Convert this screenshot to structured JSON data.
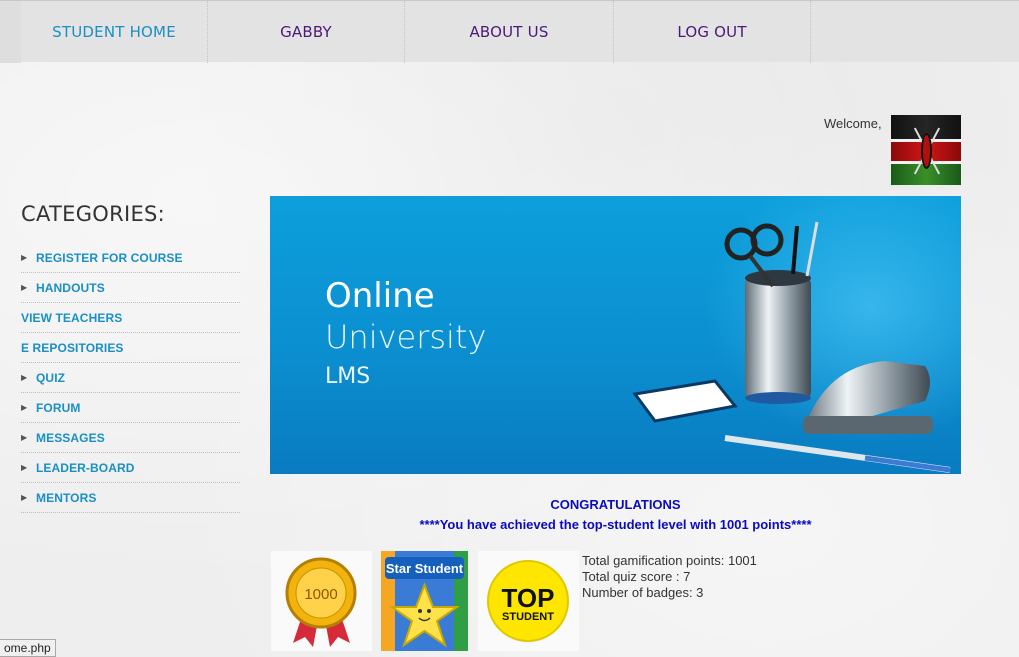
{
  "nav": {
    "items": [
      {
        "label": "STUDENT HOME",
        "active": true
      },
      {
        "label": "GABBY",
        "active": false
      },
      {
        "label": "ABOUT US",
        "active": false
      },
      {
        "label": "LOG OUT",
        "active": false
      }
    ]
  },
  "header": {
    "welcome": "Welcome,",
    "avatar_icon": "kenya-flag-avatar"
  },
  "sidebar": {
    "title": "CATEGORIES:",
    "items": [
      {
        "label": "REGISTER FOR COURSE",
        "arrow": true
      },
      {
        "label": "HANDOUTS",
        "arrow": true
      },
      {
        "label": "VIEW TEACHERS",
        "arrow": false
      },
      {
        "label": "E REPOSITORIES",
        "arrow": false
      },
      {
        "label": "QUIZ",
        "arrow": true
      },
      {
        "label": "FORUM",
        "arrow": true
      },
      {
        "label": "MESSAGES",
        "arrow": true
      },
      {
        "label": "LEADER-BOARD",
        "arrow": true
      },
      {
        "label": "MENTORS",
        "arrow": true
      }
    ]
  },
  "banner": {
    "line1": "Online",
    "line2": "University",
    "line3": "LMS"
  },
  "messages": {
    "congrats": "CONGRATULATIONS",
    "achievement": "****You have achieved the top-student level with 1001 points****"
  },
  "badges": {
    "badge1_text": "1000",
    "badge2_text": "Star Student",
    "badge3_line1": "TOP",
    "badge3_line2": "STUDENT"
  },
  "stats": {
    "points": "Total gamification points: 1001",
    "quiz": "Total quiz score : 7",
    "badges": "Number of badges: 3"
  },
  "statusbar": {
    "url": "ome.php"
  },
  "colors": {
    "accent": "#1a8fc4",
    "nav_text": "#4a1a7a",
    "message": "#0a0ac0",
    "banner": "#0b8fd0"
  }
}
